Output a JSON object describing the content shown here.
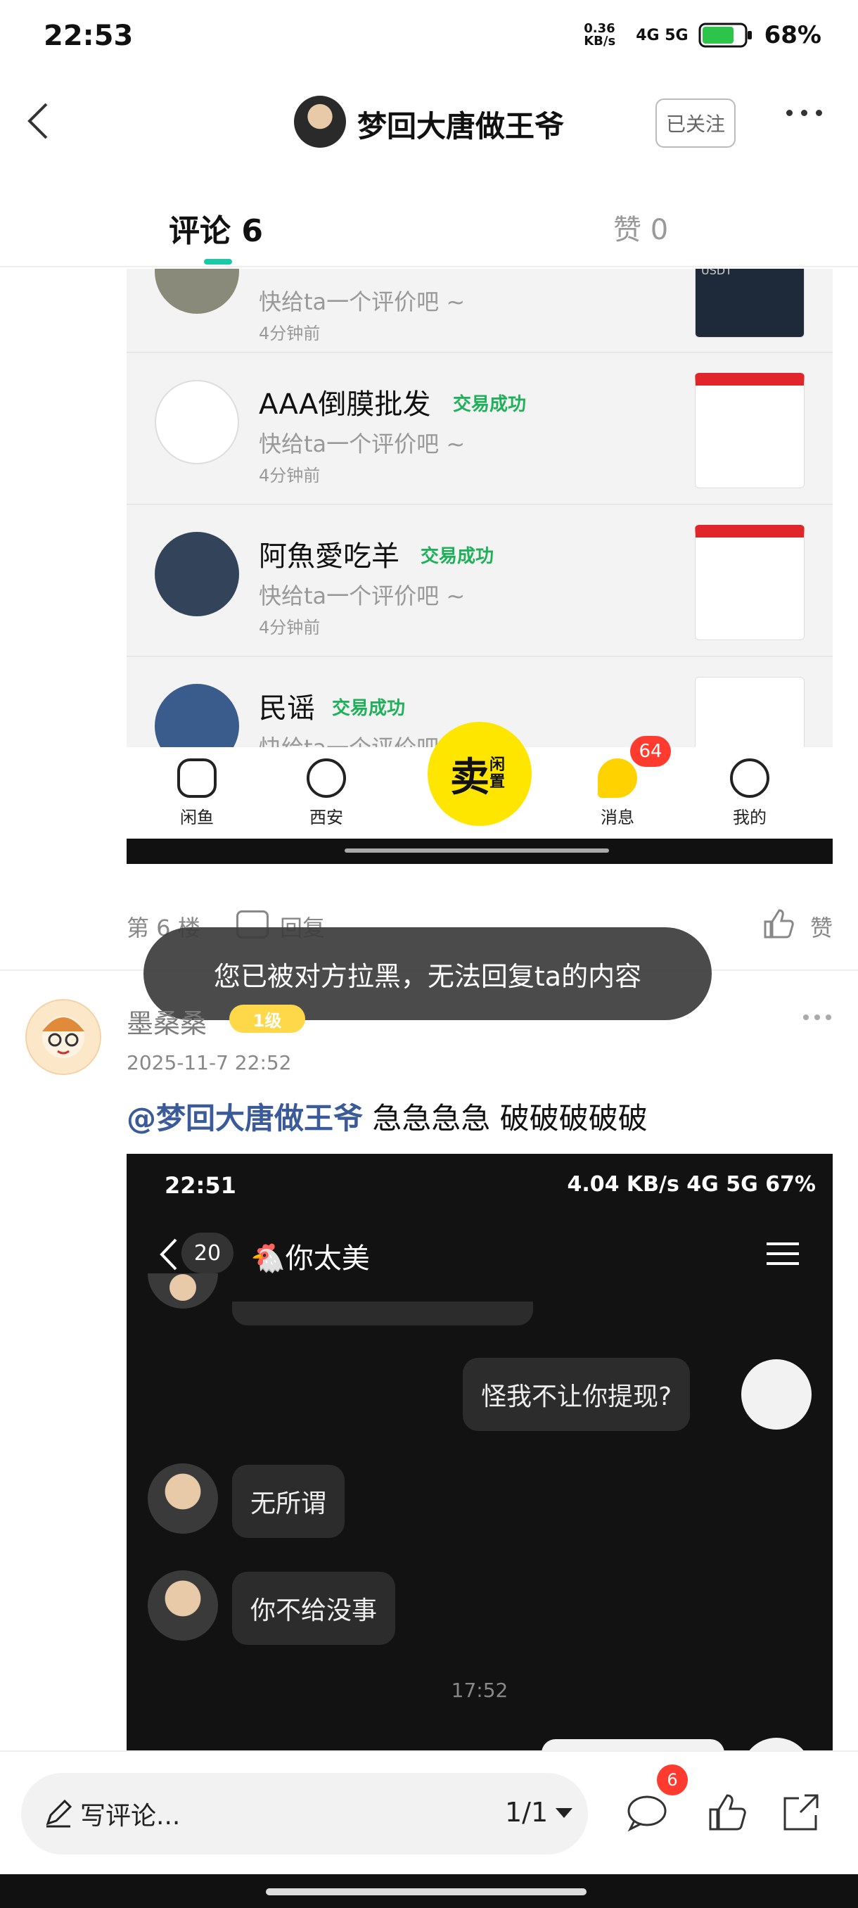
{
  "status_bar": {
    "time": "22:53",
    "speed": "0.36 KB/s",
    "network": "4G 5G",
    "battery": "68%"
  },
  "header": {
    "username": "梦回大唐做王爷",
    "follow_label": "已关注"
  },
  "tabs": {
    "comments": "评论 6",
    "likes": "赞 0"
  },
  "screenshot1": {
    "reviews": [
      {
        "name": "",
        "badge": "",
        "text": "快给ta一个评价吧 ~",
        "time": "4分钟前"
      },
      {
        "name": "AAA倒膜批发",
        "badge": "交易成功",
        "text": "快给ta一个评价吧 ~",
        "time": "4分钟前"
      },
      {
        "name": "阿魚愛吃羊",
        "badge": "交易成功",
        "text": "快给ta一个评价吧 ~",
        "time": "4分钟前"
      },
      {
        "name": "民谣",
        "badge": "交易成功",
        "text": "快给ta一个评价吧 ~",
        "time": ""
      }
    ],
    "nav": {
      "home": "闲鱼",
      "local": "西安",
      "sell": "卖",
      "sell_sub": "闲置",
      "messages": "消息",
      "messages_badge": "64",
      "me": "我的"
    },
    "thumb_text": "USDT"
  },
  "floor": {
    "label": "第 6 楼",
    "reply": "回复",
    "like": "赞"
  },
  "toast": "您已被对方拉黑，无法回复ta的内容",
  "comment2": {
    "name": "墨桑桑",
    "level": "1级",
    "time": "2025-11-7 22:52",
    "mention": "@梦回大唐做王爷",
    "text": " 急急急急 破破破破破"
  },
  "screenshot2": {
    "time": "22:51",
    "status": "4.04 KB/s 4G 5G 67%",
    "unread": "20",
    "title": "🐔你太美",
    "messages": [
      {
        "from": "me",
        "text": "怪我不让你提现?"
      },
      {
        "from": "them",
        "text": "无所谓"
      },
      {
        "from": "them",
        "text": "你不给没事"
      }
    ],
    "stamp": "17:52"
  },
  "bottom_bar": {
    "placeholder": "写评论...",
    "page": "1/1",
    "comment_badge": "6"
  }
}
